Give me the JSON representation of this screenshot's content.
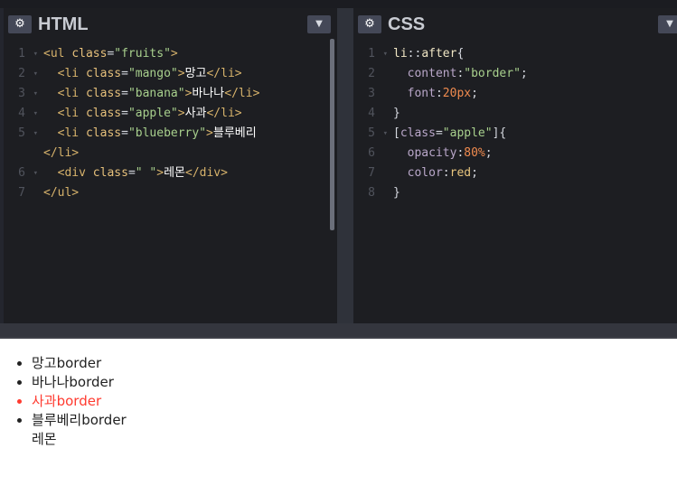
{
  "html_editor": {
    "title": "HTML",
    "lines": [
      {
        "num": "1",
        "fold": "▾",
        "code": [
          [
            "tag",
            "<ul "
          ],
          [
            "attr",
            "class"
          ],
          [
            "punc",
            "="
          ],
          [
            "str",
            "\"fruits\""
          ],
          [
            "tag",
            ">"
          ]
        ]
      },
      {
        "num": "2",
        "fold": "▾",
        "code": [
          [
            "punc",
            "  "
          ],
          [
            "tag",
            "<li "
          ],
          [
            "attr",
            "class"
          ],
          [
            "punc",
            "="
          ],
          [
            "str",
            "\"mango\""
          ],
          [
            "tag",
            ">"
          ],
          [
            "kor",
            "망고"
          ],
          [
            "tag",
            "</li>"
          ]
        ]
      },
      {
        "num": "3",
        "fold": "▾",
        "code": [
          [
            "punc",
            "  "
          ],
          [
            "tag",
            "<li "
          ],
          [
            "attr",
            "class"
          ],
          [
            "punc",
            "="
          ],
          [
            "str",
            "\"banana\""
          ],
          [
            "tag",
            ">"
          ],
          [
            "kor",
            "바나나"
          ],
          [
            "tag",
            "</li>"
          ]
        ]
      },
      {
        "num": "4",
        "fold": "▾",
        "code": [
          [
            "punc",
            "  "
          ],
          [
            "tag",
            "<li "
          ],
          [
            "attr",
            "class"
          ],
          [
            "punc",
            "="
          ],
          [
            "str",
            "\"apple\""
          ],
          [
            "tag",
            ">"
          ],
          [
            "kor",
            "사과"
          ],
          [
            "tag",
            "</li>"
          ]
        ]
      },
      {
        "num": "5",
        "fold": "▾",
        "code": [
          [
            "punc",
            "  "
          ],
          [
            "tag",
            "<li "
          ],
          [
            "attr",
            "class"
          ],
          [
            "punc",
            "="
          ],
          [
            "str",
            "\"blueberry\""
          ],
          [
            "tag",
            ">"
          ],
          [
            "kor",
            "블루베리"
          ]
        ]
      },
      {
        "num": "",
        "fold": "",
        "code": [
          [
            "tag",
            "</li>"
          ]
        ]
      },
      {
        "num": "6",
        "fold": "▾",
        "code": [
          [
            "punc",
            "  "
          ],
          [
            "tag",
            "<div "
          ],
          [
            "attr",
            "class"
          ],
          [
            "punc",
            "="
          ],
          [
            "str",
            "\" \""
          ],
          [
            "tag",
            ">"
          ],
          [
            "kor",
            "레몬"
          ],
          [
            "tag",
            "</div>"
          ]
        ]
      },
      {
        "num": "7",
        "fold": "",
        "code": [
          [
            "tag",
            "</ul>"
          ]
        ]
      }
    ]
  },
  "css_editor": {
    "title": "CSS",
    "lines": [
      {
        "num": "1",
        "fold": "▾",
        "code": [
          [
            "sel",
            "li"
          ],
          [
            "punc",
            "::"
          ],
          [
            "sel",
            "after"
          ],
          [
            "punc",
            "{"
          ]
        ]
      },
      {
        "num": "2",
        "fold": "",
        "code": [
          [
            "punc",
            "  "
          ],
          [
            "prop",
            "content"
          ],
          [
            "punc",
            ":"
          ],
          [
            "str",
            "\"border\""
          ],
          [
            "punc",
            ";"
          ]
        ]
      },
      {
        "num": "3",
        "fold": "",
        "code": [
          [
            "punc",
            "  "
          ],
          [
            "prop",
            "font"
          ],
          [
            "punc",
            ":"
          ],
          [
            "num",
            "20px"
          ],
          [
            "punc",
            ";"
          ]
        ]
      },
      {
        "num": "4",
        "fold": "",
        "code": [
          [
            "punc",
            "}"
          ]
        ]
      },
      {
        "num": "5",
        "fold": "▾",
        "code": [
          [
            "punc",
            "["
          ],
          [
            "prop",
            "class"
          ],
          [
            "punc",
            "="
          ],
          [
            "str",
            "\"apple\""
          ],
          [
            "punc",
            "]{"
          ]
        ]
      },
      {
        "num": "6",
        "fold": "",
        "code": [
          [
            "punc",
            "  "
          ],
          [
            "prop",
            "opacity"
          ],
          [
            "punc",
            ":"
          ],
          [
            "num",
            "80%"
          ],
          [
            "punc",
            ";"
          ]
        ]
      },
      {
        "num": "7",
        "fold": "",
        "code": [
          [
            "punc",
            "  "
          ],
          [
            "prop",
            "color"
          ],
          [
            "punc",
            ":"
          ],
          [
            "val",
            "red"
          ],
          [
            "punc",
            ";"
          ]
        ]
      },
      {
        "num": "8",
        "fold": "",
        "code": [
          [
            "punc",
            "}"
          ]
        ]
      }
    ]
  },
  "icons": {
    "settings": "gear-icon",
    "collapse": "chevron-down-icon"
  },
  "colors": {
    "apple_text": "#ff3b30",
    "editor_bg": "#1d1e22"
  },
  "result": {
    "items": [
      {
        "name": "mango",
        "text": "망고border"
      },
      {
        "name": "banana",
        "text": "바나나border"
      },
      {
        "name": "apple",
        "text": "사과border"
      },
      {
        "name": "blueberry",
        "text": "블루베리border"
      }
    ],
    "lemon": "레몬"
  }
}
